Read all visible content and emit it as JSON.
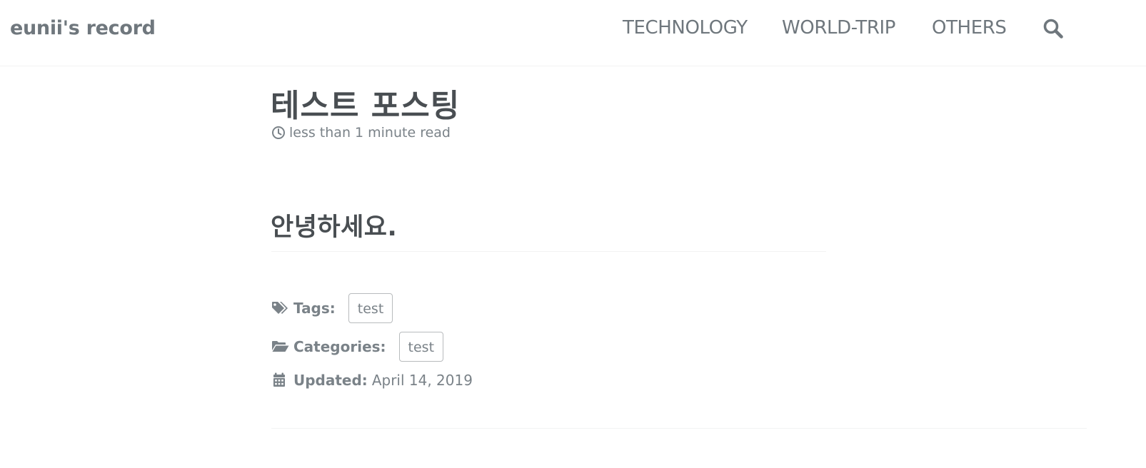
{
  "masthead": {
    "site_title": "eunii's record",
    "nav": [
      {
        "label": "TECHNOLOGY"
      },
      {
        "label": "WORLD-TRIP"
      },
      {
        "label": "OTHERS"
      }
    ],
    "search_icon": "search-icon"
  },
  "post": {
    "title": "테스트 포스팅",
    "read_time": "less than 1 minute read",
    "read_time_icon": "clock-icon",
    "heading": "안녕하세요.",
    "tags": {
      "icon": "tags-icon",
      "label": "Tags:",
      "items": [
        "test"
      ]
    },
    "categories": {
      "icon": "folder-open-icon",
      "label": "Categories:",
      "items": [
        "test"
      ]
    },
    "updated": {
      "icon": "calendar-icon",
      "label": "Updated:",
      "date": "April 14, 2019"
    }
  },
  "colors": {
    "text": "#494e52",
    "muted": "#7a8288",
    "nav": "#6f777d",
    "border": "#f2f3f3"
  }
}
